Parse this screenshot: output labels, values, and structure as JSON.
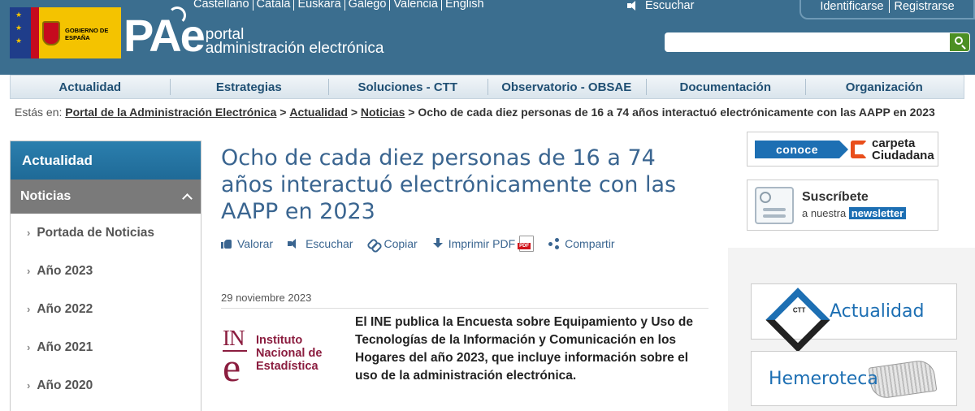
{
  "header": {
    "gov_logo_text": "GOBIERNO DE ESPAÑA",
    "portal_logo": {
      "big": "PAe",
      "line1": "portal",
      "line2": "administración electrónica"
    },
    "languages": [
      "Castellano",
      "Català",
      "Euskara",
      "Galego",
      "Valencià",
      "English"
    ],
    "listen_label": "Escuchar",
    "login": {
      "identify": "Identificarse",
      "register": "Registrarse"
    },
    "search": {
      "placeholder": "",
      "value": ""
    }
  },
  "nav": {
    "items": [
      "Actualidad",
      "Estrategias",
      "Soluciones - CTT",
      "Observatorio - OBSAE",
      "Documentación",
      "Organización"
    ]
  },
  "breadcrumb": {
    "prefix": "Estás en:",
    "links": [
      "Portal de la Administración Electrónica",
      "Actualidad",
      "Noticias"
    ],
    "current": "Ocho de cada diez personas de 16 a 74 años interactuó electrónicamente con las AAPP en 2023"
  },
  "sidebar": {
    "header": "Actualidad",
    "section": "Noticias",
    "items": [
      "Portada de Noticias",
      "Año 2023",
      "Año 2022",
      "Año 2021",
      "Año 2020"
    ]
  },
  "article": {
    "title": "Ocho de cada diez personas de 16 a 74 años interactuó electrónicamente con las AAPP en 2023",
    "actions": {
      "rate": "Valorar",
      "listen": "Escuchar",
      "copy": "Copiar",
      "print": "Imprimir PDF",
      "share": "Compartir"
    },
    "date": "29 noviembre 2023",
    "ine_logo": {
      "mark_top": "IN",
      "mark_bottom": "e",
      "line1": "Instituto",
      "line2": "Nacional de",
      "line3": "Estadística"
    },
    "lead": "El INE publica la Encuesta sobre Equipamiento y Uso de Tecnologías de la Información y Comunicación en los Hogares del año 2023, que incluye información sobre el uso de la administración electrónica."
  },
  "right": {
    "carpeta": {
      "conoce": "conoce",
      "line1": "carpeta",
      "line2": "Ciudadana"
    },
    "newsletter": {
      "line1": "Suscríbete",
      "line2": "a nuestra",
      "tag": "newsletter"
    },
    "ctt": {
      "badge": "CTT",
      "label": "Actualidad"
    },
    "hemeroteca": {
      "label": "Hemeroteca"
    }
  },
  "colors": {
    "header_bg": "#3b6e8f",
    "link_blue": "#3a6590",
    "sidebar_blue": "#1f6a97",
    "ine_red": "#8b1d3f",
    "accent_green": "#4c8f24"
  }
}
